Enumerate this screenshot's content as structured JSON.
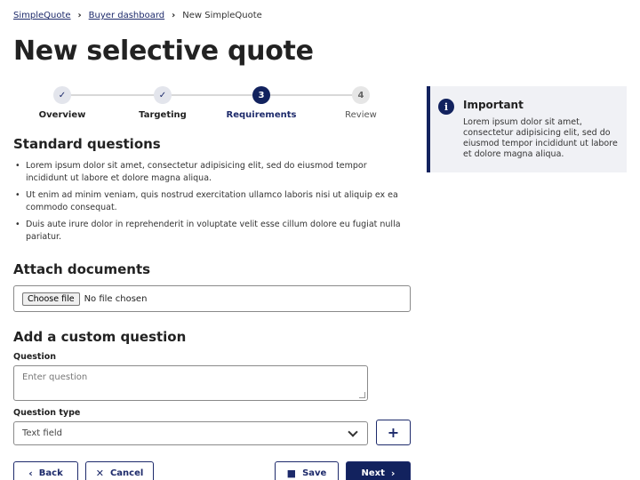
{
  "breadcrumb": {
    "items": [
      "SimpleQuote",
      "Buyer dashboard"
    ],
    "current": "New SimpleQuote"
  },
  "page_title": "New selective quote",
  "stepper": {
    "steps": [
      {
        "number": "✓",
        "label": "Overview",
        "state": "done"
      },
      {
        "number": "✓",
        "label": "Targeting",
        "state": "done"
      },
      {
        "number": "3",
        "label": "Requirements",
        "state": "active"
      },
      {
        "number": "4",
        "label": "Review",
        "state": "todo"
      }
    ]
  },
  "standard_questions": {
    "heading": "Standard questions",
    "items": [
      "Lorem ipsum dolor sit amet, consectetur adipisicing elit, sed do eiusmod tempor incididunt ut labore et dolore magna aliqua.",
      "Ut enim ad minim veniam, quis nostrud exercitation ullamco laboris nisi ut aliquip ex ea commodo consequat.",
      "Duis aute irure dolor in reprehenderit in voluptate velit esse cillum dolore eu fugiat nulla pariatur."
    ]
  },
  "attach": {
    "heading": "Attach documents",
    "button_label": "Choose file",
    "status": "No file chosen"
  },
  "custom_question": {
    "heading": "Add a custom question",
    "question_label": "Question",
    "question_placeholder": "Enter question",
    "type_label": "Question type",
    "type_value": "Text field",
    "add_label": "+"
  },
  "actions": {
    "back": "Back",
    "cancel": "Cancel",
    "save": "Save",
    "next": "Next"
  },
  "callout": {
    "title": "Important",
    "body": "Lorem ipsum dolor sit amet, consectetur adipisicing elit, sed do eiusmod tempor incididunt ut labore et dolore magna aliqua."
  },
  "colors": {
    "primary": "#12225e",
    "callout_bg": "#f0f1f5"
  }
}
